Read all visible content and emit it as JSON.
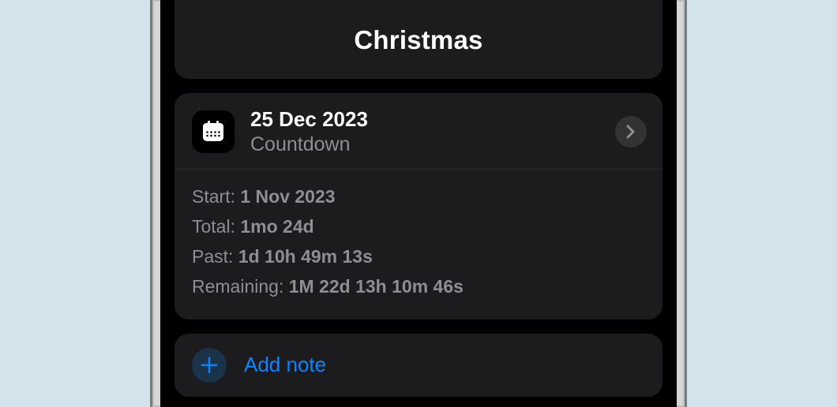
{
  "header": {
    "title": "Christmas"
  },
  "countdown": {
    "date": "25 Dec 2023",
    "subtitle": "Countdown"
  },
  "stats": {
    "start_label": "Start:",
    "start_value": "1 Nov 2023",
    "total_label": "Total:",
    "total_value": "1mo 24d",
    "past_label": "Past:",
    "past_value": "1d 10h 49m 13s",
    "remaining_label": "Remaining:",
    "remaining_value": "1M 22d 13h 10m 46s"
  },
  "addnote": {
    "label": "Add note"
  }
}
